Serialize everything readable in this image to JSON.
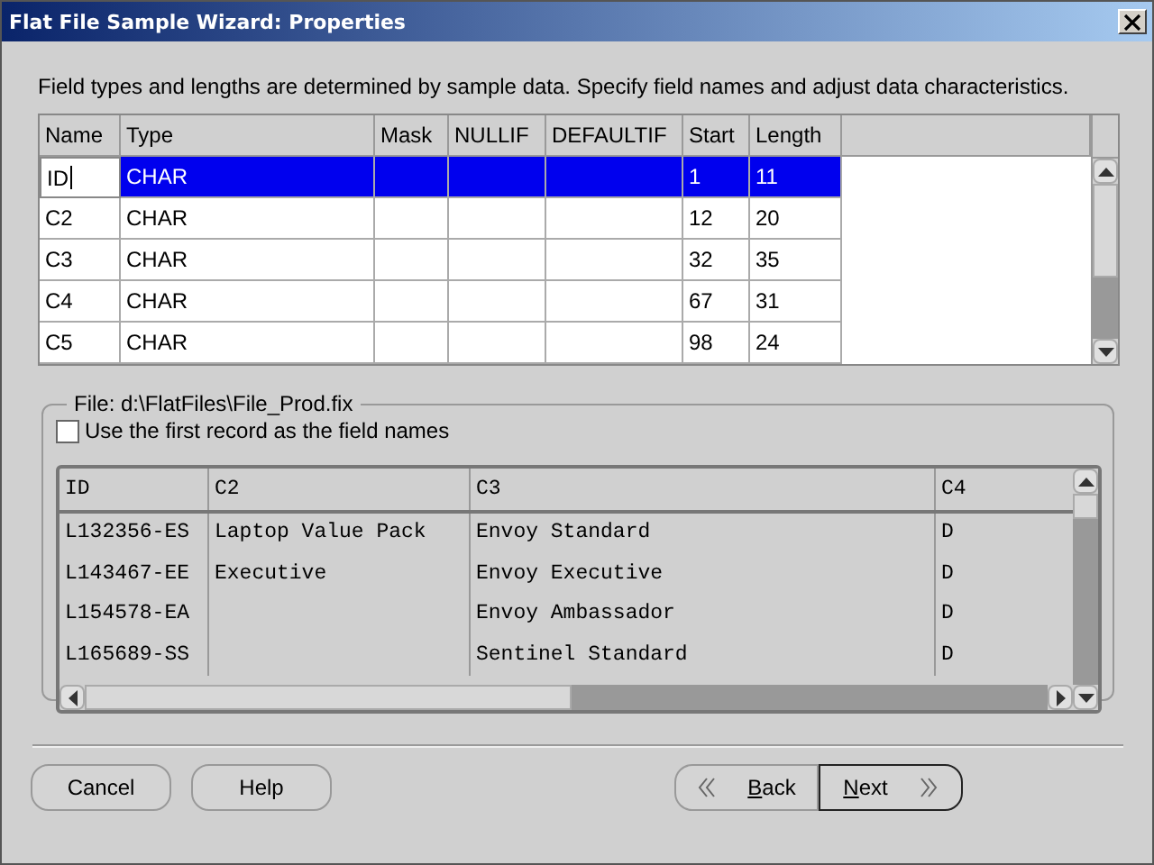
{
  "window": {
    "title": "Flat File Sample Wizard: Properties"
  },
  "instruction": "Field types and lengths are determined by sample data.  Specify field names and adjust data characteristics.",
  "fields_table": {
    "columns": [
      "Name",
      "Type",
      "Mask",
      "NULLIF",
      "DEFAULTIF",
      "Start",
      "Length"
    ],
    "rows": [
      {
        "cells": [
          "ID",
          "CHAR",
          "",
          "",
          "",
          "1",
          "11"
        ],
        "selected": true,
        "editing": true
      },
      {
        "cells": [
          "C2",
          "CHAR",
          "",
          "",
          "",
          "12",
          "20"
        ],
        "selected": false,
        "editing": false
      },
      {
        "cells": [
          "C3",
          "CHAR",
          "",
          "",
          "",
          "32",
          "35"
        ],
        "selected": false,
        "editing": false
      },
      {
        "cells": [
          "C4",
          "CHAR",
          "",
          "",
          "",
          "67",
          "31"
        ],
        "selected": false,
        "editing": false
      },
      {
        "cells": [
          "C5",
          "CHAR",
          "",
          "",
          "",
          "98",
          "24"
        ],
        "selected": false,
        "editing": false
      }
    ]
  },
  "file_group": {
    "legend": "File: d:\\FlatFiles\\File_Prod.fix",
    "checkbox": {
      "label": "Use the first record as the field names",
      "checked": false
    },
    "sample_table": {
      "columns": [
        "ID",
        "C2",
        "C3",
        "C4"
      ],
      "rows": [
        [
          "L132356-ES",
          "Laptop Value Pack",
          "Envoy Standard",
          "D"
        ],
        [
          "L143467-EE",
          "Executive",
          "Envoy Executive",
          "D"
        ],
        [
          "L154578-EA",
          "",
          "Envoy Ambassador",
          "D"
        ],
        [
          "L165689-SS",
          "",
          "Sentinel Standard",
          "D"
        ]
      ]
    }
  },
  "buttons": [
    {
      "label": "Cancel",
      "kind": "plain",
      "mnemonic": false,
      "default": false
    },
    {
      "label": "Help",
      "kind": "plain",
      "mnemonic": false,
      "default": false
    },
    {
      "label": "Back",
      "kind": "back",
      "mnemonic": true,
      "default": false
    },
    {
      "label": "Next",
      "kind": "next",
      "mnemonic": true,
      "default": true
    }
  ]
}
